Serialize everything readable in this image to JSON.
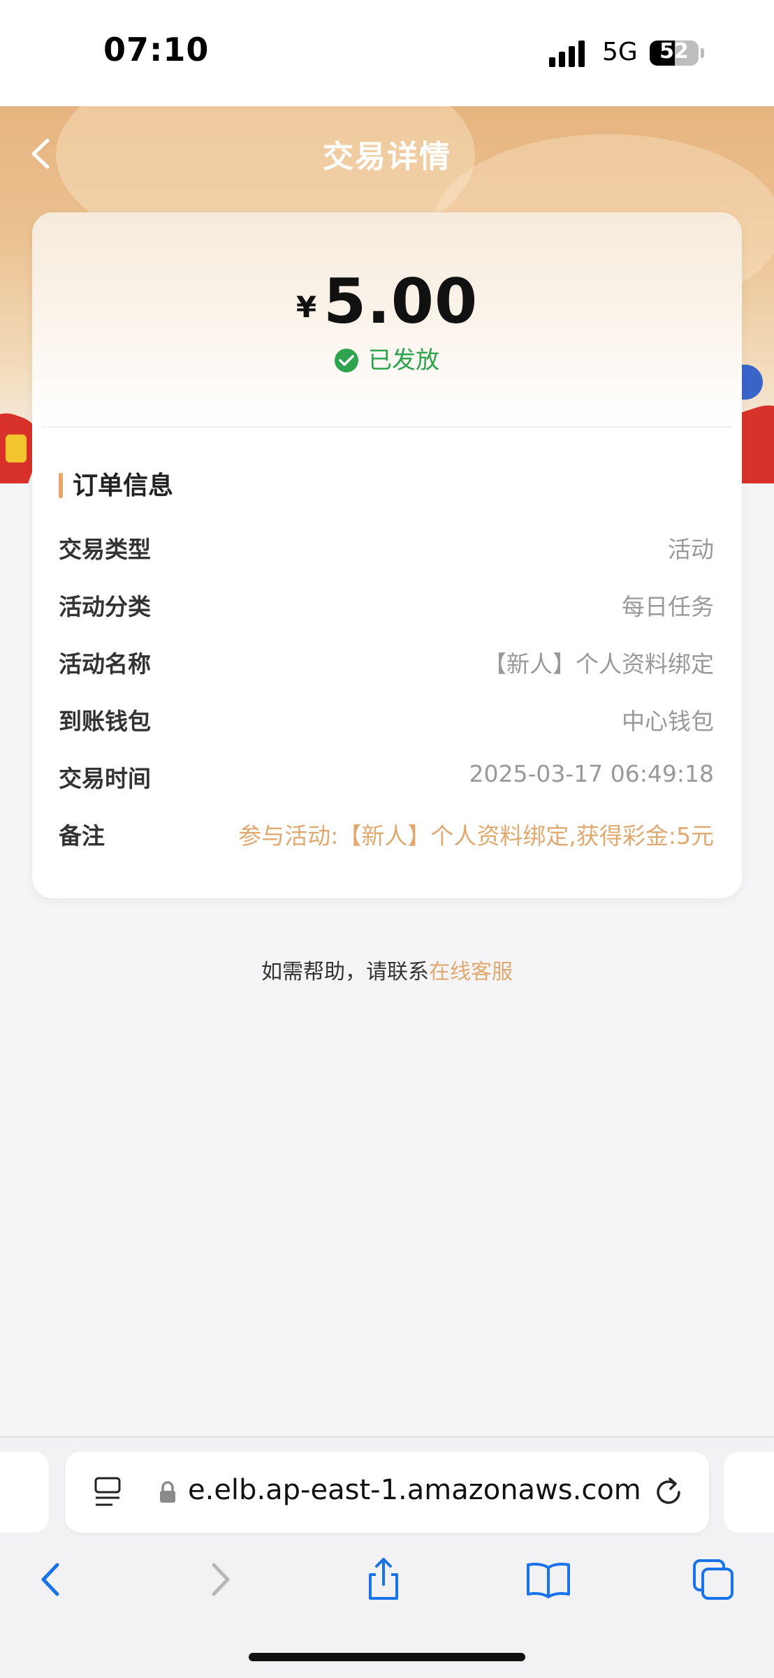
{
  "status_bar": {
    "time": "07:10",
    "network": "5G",
    "battery": "52",
    "battery_level": 0.52
  },
  "header": {
    "title": "交易详情"
  },
  "summary": {
    "currency": "¥",
    "amount": "5.00",
    "status": "已发放"
  },
  "order": {
    "section_title": "订单信息",
    "rows": [
      {
        "label": "交易类型",
        "value": "活动"
      },
      {
        "label": "活动分类",
        "value": "每日任务"
      },
      {
        "label": "活动名称",
        "value": "【新人】个人资料绑定"
      },
      {
        "label": "到账钱包",
        "value": "中心钱包"
      },
      {
        "label": "交易时间",
        "value": "2025-03-17 06:49:18"
      },
      {
        "label": "备注",
        "value": "参与活动:【新人】个人资料绑定,获得彩金:5元"
      }
    ]
  },
  "help": {
    "text": "如需帮助，请联系",
    "link": "在线客服"
  },
  "browser": {
    "url": "e.elb.ap-east-1.amazonaws.com"
  },
  "colors": {
    "accent": "#e0a96f",
    "success": "#2ea44f",
    "link_blue": "#1a73e8"
  }
}
